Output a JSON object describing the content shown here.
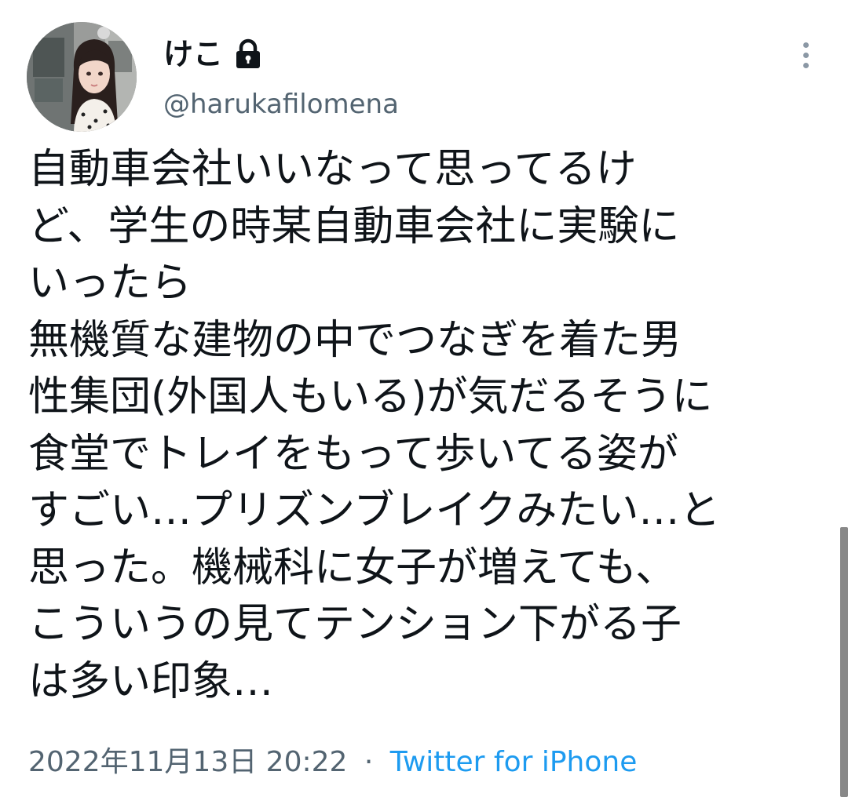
{
  "author": {
    "display_name": "けこ",
    "handle": "@harukafilomena",
    "protected_icon": "lock-icon",
    "avatar_icon": "profile-photo"
  },
  "tweet": {
    "text": "自動車会社いいなって思ってるけ\nど、学生の時某自動車会社に実験に\nいったら\n無機質な建物の中でつなぎを着た男\n性集団(外国人もいる)が気だるそうに\n食堂でトレイをもって歩いてる姿が\nすごい…プリズンブレイクみたい…と\n思った。機械科に女子が増えても、\nこういうの見てテンション下がる子\nは多い印象…",
    "timestamp": "2022年11月13日 20:22",
    "separator": "·",
    "source": "Twitter for iPhone"
  },
  "menu": {
    "more_icon": "more-vertical-icon"
  },
  "colors": {
    "text": "#0f1419",
    "secondary": "#536471",
    "link": "#1d9bf0"
  }
}
